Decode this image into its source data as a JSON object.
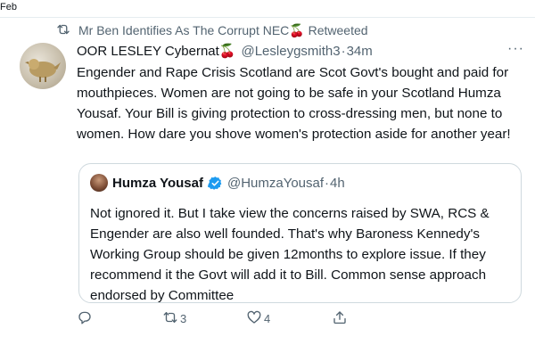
{
  "top_fragment": "Feb",
  "retweet_context": {
    "label": "Mr Ben Identifies As The Corrupt NEC🍒 Retweeted"
  },
  "tweet": {
    "author_name": "OOR LESLEY Cybernat🍒",
    "handle": "@Lesleygsmith3",
    "separator": "·",
    "time": "34m",
    "more_label": "···",
    "text": "Engender and Rape Crisis Scotland are Scot Govt's bought and paid for mouthpieces. Women are not going to be safe in your Scotland Humza Yousaf. Your Bill is giving protection to cross-dressing men, but none to women. How dare you shove women's protection aside for another year!"
  },
  "quoted_tweet": {
    "author_name": "Humza Yousaf",
    "handle": "@HumzaYousaf",
    "separator": "·",
    "time": "4h",
    "text": "Not ignored it. But I take view the concerns raised by SWA, RCS & Engender are also well founded. That's why Baroness Kennedy's Working Group should be given 12months to explore issue. If they recommend it the Govt will add it to Bill. Common sense approach endorsed by Committee"
  },
  "actions": {
    "reply_count": "",
    "retweet_count": "3",
    "like_count": "4"
  },
  "colors": {
    "text_primary": "#0f1419",
    "text_secondary": "#536471",
    "verified_blue": "#1d9bf0",
    "border": "#cfd9de"
  },
  "icons": {
    "retweet_context": "retweet-icon",
    "verified": "verified-badge-icon",
    "reply": "reply-icon",
    "retweet": "retweet-icon",
    "like": "heart-icon",
    "share": "share-icon"
  }
}
